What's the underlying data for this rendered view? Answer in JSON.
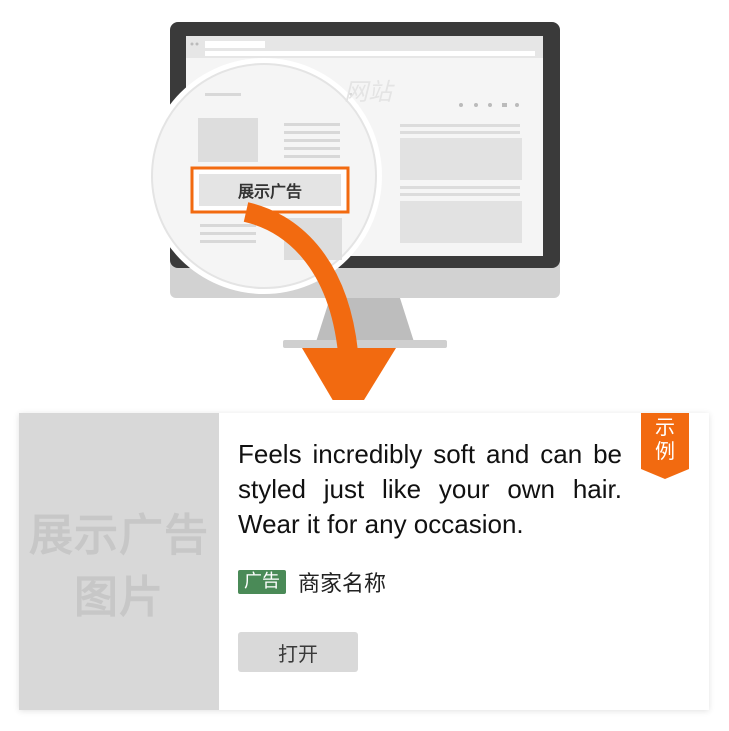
{
  "illustration": {
    "watermark_text": "网站",
    "highlighted_ad_label": "展示广告",
    "accent_color": "#f26a10"
  },
  "ad": {
    "image_placeholder": {
      "line1": "展示广告",
      "line2": "图片"
    },
    "description": "Feels incredibly soft and can be styled just like your own hair. Wear it for any occasion.",
    "badge": "广告",
    "badge_color": "#4a8a57",
    "advertiser": "商家名称",
    "open_button_label": "打开",
    "example_tag": "示例",
    "example_tag_color": "#f26a10"
  }
}
